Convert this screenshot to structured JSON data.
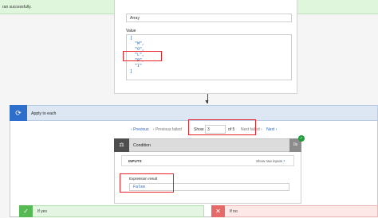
{
  "banner": {
    "text": "ran successfully."
  },
  "compose": {
    "type_value": "Array",
    "value_label": "Value",
    "value_lines": [
      "[",
      "  \"M\",",
      "  \"O\",",
      "  \"L\",",
      "  \"R\",",
      "  \"I\"",
      "]"
    ]
  },
  "foreach": {
    "title": "Apply to each",
    "pager": {
      "previous": "Previous",
      "previous_failed": "Previous failed",
      "show": "Show",
      "current": "3",
      "of": "of 5",
      "next_failed": "Next failed",
      "next": "Next"
    }
  },
  "condition": {
    "title": "Condition",
    "duration": "0s",
    "inputs_label": "INPUTS",
    "show_raw": "Show raw inputs",
    "expression_label": "Expression result",
    "expression_value": "False"
  },
  "branches": {
    "yes": "If yes",
    "no": "If no"
  },
  "colors": {
    "highlight": "#e8232a",
    "accent": "#2f6fcb",
    "success": "#1f9d3a"
  }
}
